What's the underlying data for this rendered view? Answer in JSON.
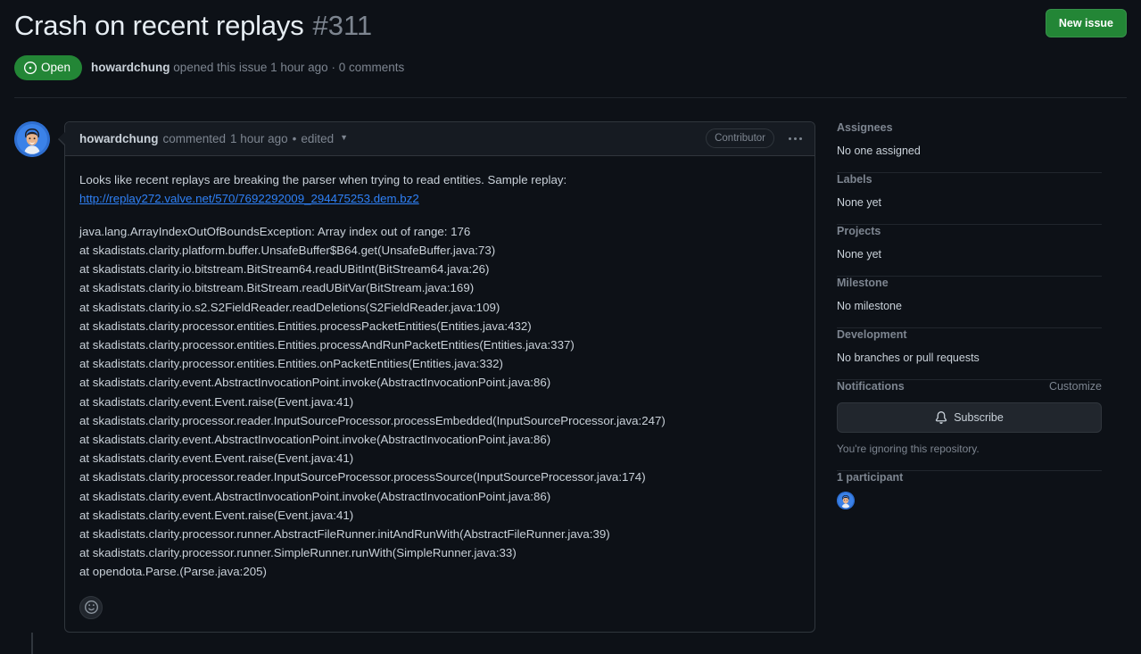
{
  "header": {
    "title": "Crash on recent replays",
    "number": "#311",
    "new_issue_label": "New issue",
    "state_label": "Open",
    "state_color": "#238636",
    "meta_author": "howardchung",
    "meta_opened": "opened this issue",
    "meta_time": "1 hour ago",
    "meta_separator": "·",
    "meta_comments": "0 comments"
  },
  "comment": {
    "author": "howardchung",
    "action": "commented",
    "time": "1 hour ago",
    "dot": "•",
    "edited": "edited",
    "contributor_badge": "Contributor",
    "intro_prefix": "Looks like recent replays are breaking the parser when trying to read entities. Sample replay: ",
    "link_text": "http://replay272.valve.net/570/7692292009_294475253.dem.bz2",
    "link_color": "#2f81f7",
    "stack_trace": "java.lang.ArrayIndexOutOfBoundsException: Array index out of range: 176\nat skadistats.clarity.platform.buffer.UnsafeBuffer$B64.get(UnsafeBuffer.java:73)\nat skadistats.clarity.io.bitstream.BitStream64.readUBitInt(BitStream64.java:26)\nat skadistats.clarity.io.bitstream.BitStream.readUBitVar(BitStream.java:169)\nat skadistats.clarity.io.s2.S2FieldReader.readDeletions(S2FieldReader.java:109)\nat skadistats.clarity.processor.entities.Entities.processPacketEntities(Entities.java:432)\nat skadistats.clarity.processor.entities.Entities.processAndRunPacketEntities(Entities.java:337)\nat skadistats.clarity.processor.entities.Entities.onPacketEntities(Entities.java:332)\nat skadistats.clarity.event.AbstractInvocationPoint.invoke(AbstractInvocationPoint.java:86)\nat skadistats.clarity.event.Event.raise(Event.java:41)\nat skadistats.clarity.processor.reader.InputSourceProcessor.processEmbedded(InputSourceProcessor.java:247)\nat skadistats.clarity.event.AbstractInvocationPoint.invoke(AbstractInvocationPoint.java:86)\nat skadistats.clarity.event.Event.raise(Event.java:41)\nat skadistats.clarity.processor.reader.InputSourceProcessor.processSource(InputSourceProcessor.java:174)\nat skadistats.clarity.event.AbstractInvocationPoint.invoke(AbstractInvocationPoint.java:86)\nat skadistats.clarity.event.Event.raise(Event.java:41)\nat skadistats.clarity.processor.runner.AbstractFileRunner.initAndRunWith(AbstractFileRunner.java:39)\nat skadistats.clarity.processor.runner.SimpleRunner.runWith(SimpleRunner.java:33)\nat opendota.Parse.(Parse.java:205)"
  },
  "sidebar": {
    "assignees": {
      "title": "Assignees",
      "value": "No one assigned"
    },
    "labels": {
      "title": "Labels",
      "value": "None yet"
    },
    "projects": {
      "title": "Projects",
      "value": "None yet"
    },
    "milestone": {
      "title": "Milestone",
      "value": "No milestone"
    },
    "development": {
      "title": "Development",
      "value": "No branches or pull requests"
    },
    "notifications": {
      "title": "Notifications",
      "customize": "Customize",
      "subscribe_label": "Subscribe",
      "ignore_note": "You're ignoring this repository."
    },
    "participants": {
      "count_label": "1 participant"
    }
  }
}
